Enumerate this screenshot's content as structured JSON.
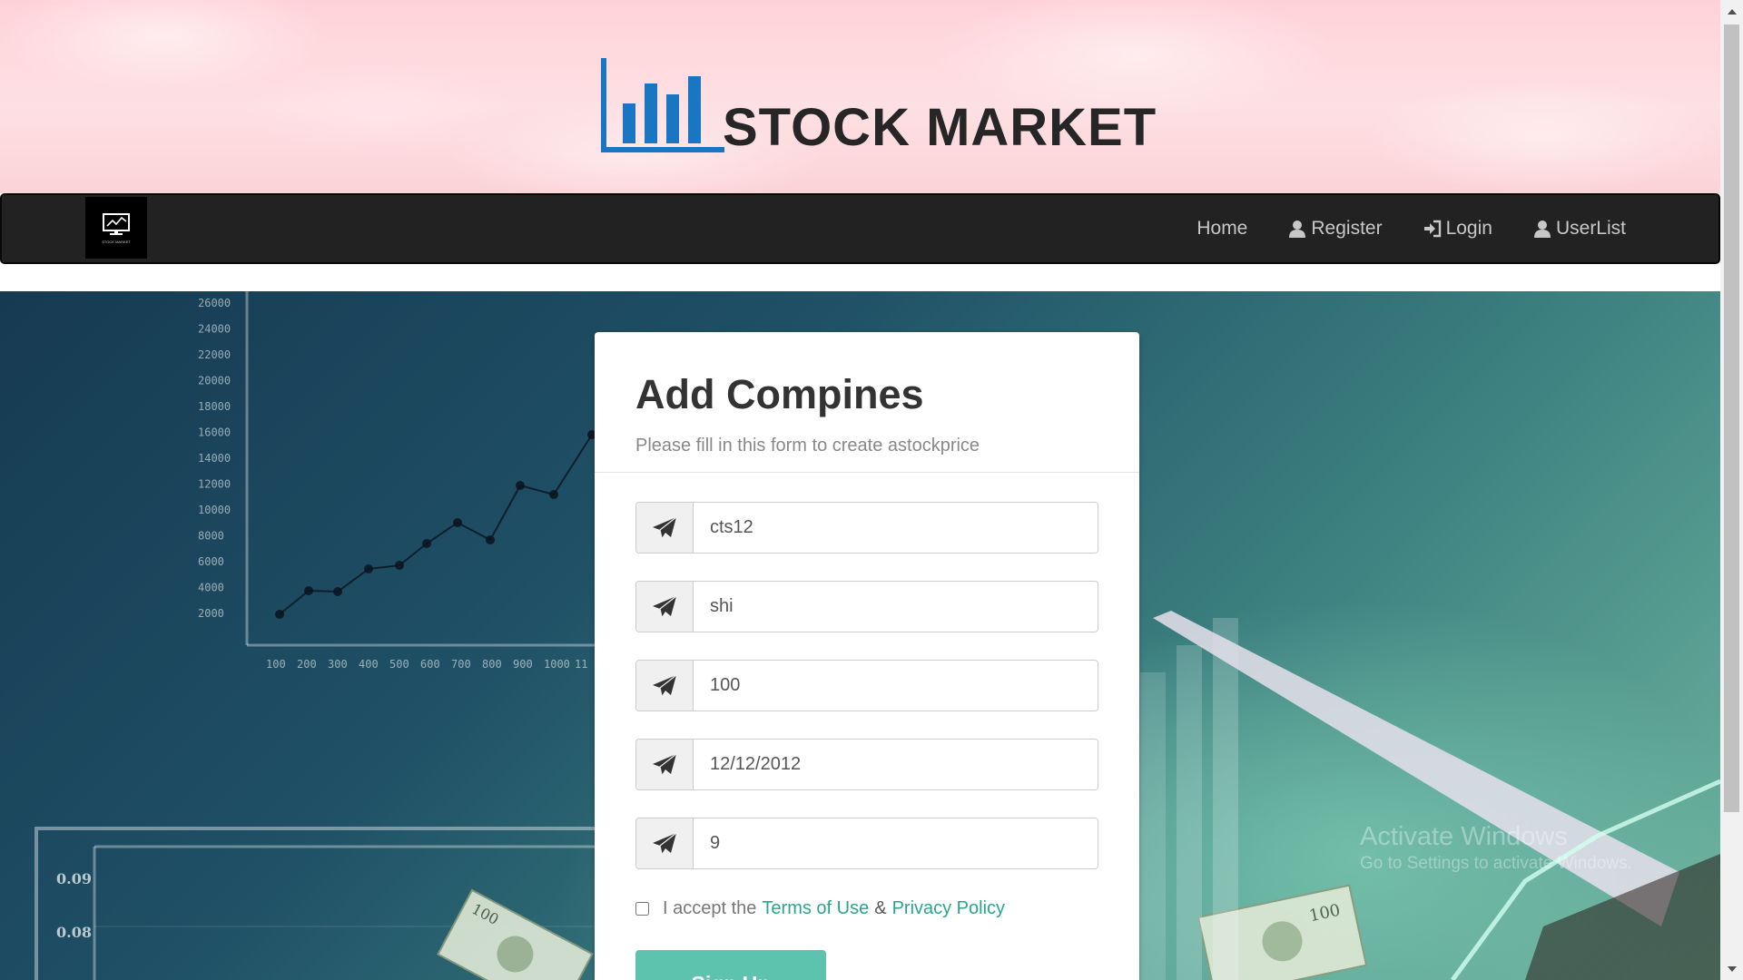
{
  "header": {
    "brand_title": "STOCK MARKET",
    "brand_logo_icon": "bar-chart-icon"
  },
  "navbar": {
    "logo_icon": "monitor-chart-icon",
    "logo_caption": "STOCK MARKET",
    "links": [
      {
        "label": "Home",
        "icon": ""
      },
      {
        "label": "Register",
        "icon": "user-icon"
      },
      {
        "label": "Login",
        "icon": "sign-in-icon"
      },
      {
        "label": "UserList",
        "icon": "user-icon"
      }
    ]
  },
  "form": {
    "title": "Add Compines",
    "subtitle": "Please fill in this form to create astockprice",
    "field_icon": "paper-plane-icon",
    "fields": [
      {
        "value": "cts12"
      },
      {
        "value": "shi"
      },
      {
        "value": "100"
      },
      {
        "value": "12/12/2012"
      },
      {
        "value": "9"
      }
    ],
    "terms": {
      "prefix": "I accept the",
      "terms_link": "Terms of Use",
      "amp": "&",
      "privacy_link": "Privacy Policy",
      "checked": false
    },
    "submit_label": "Sign Up"
  },
  "background": {
    "chart_y_ticks": [
      "26000",
      "24000",
      "22000",
      "20000",
      "18000",
      "16000",
      "14000",
      "12000",
      "10000",
      "8000",
      "6000",
      "4000",
      "2000"
    ],
    "chart_x_ticks": [
      "100",
      "200",
      "300",
      "400",
      "500",
      "600",
      "700",
      "800",
      "900",
      "1000",
      "11"
    ],
    "lower_y_ticks": [
      "0.09",
      "0.08"
    ]
  },
  "watermark": {
    "title": "Activate Windows",
    "subtitle": "Go to Settings to activate Windows."
  },
  "colors": {
    "banner_pink": "#fdd9dd",
    "navbar": "#222222",
    "link_green": "#2aa58d",
    "button_green": "#5ec3ae",
    "logo_blue": "#1a75c2"
  }
}
